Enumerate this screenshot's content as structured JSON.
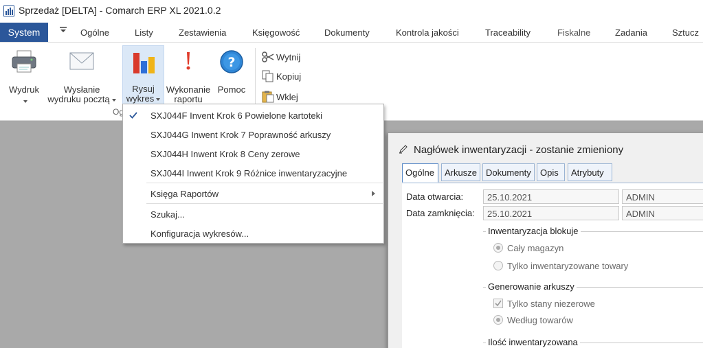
{
  "window": {
    "title": "Sprzedaż [DELTA] - Comarch ERP XL 2021.0.2"
  },
  "menubar": {
    "system": "System",
    "items": [
      "Ogólne",
      "Listy",
      "Zestawienia",
      "Księgowość",
      "Dokumenty",
      "Kontrola jakości",
      "Traceability",
      "Fiskalne",
      "Zadania",
      "Sztucz"
    ]
  },
  "ribbon": {
    "wydruk": "Wydruk",
    "wyslanie_line1": "Wysłanie",
    "wyslanie_line2": "wydruku pocztą",
    "rysuj_line1": "Rysuj",
    "rysuj_line2": "wykres",
    "wykonanie_line1": "Wykonanie",
    "wykonanie_line2": "raportu",
    "pomoc": "Pomoc",
    "wytnij": "Wytnij",
    "kopiuj": "Kopiuj",
    "wklej": "Wklej",
    "group_label": "Og"
  },
  "dropdown": {
    "items": [
      {
        "label": "SXJ044F Invent Krok 6 Powielone kartoteki",
        "checked": true
      },
      {
        "label": "SXJ044G Inwent Krok 7 Poprawność arkuszy",
        "checked": false
      },
      {
        "label": "SXJ044H Inwent Krok 8 Ceny zerowe",
        "checked": false
      },
      {
        "label": "SXJ044I Inwent Krok 9 Różnice inwentaryzacyjne",
        "checked": false
      }
    ],
    "ksiega": "Księga Raportów",
    "szukaj": "Szukaj...",
    "konfiguracja": "Konfiguracja wykresów..."
  },
  "dialog": {
    "title": "Nagłówek inwentaryzacji - zostanie zmieniony",
    "tabs": [
      "Ogólne",
      "Arkusze",
      "Dokumenty",
      "Opis",
      "Atrybuty"
    ],
    "data_otwarcia_label": "Data otwarcia:",
    "data_otwarcia_value": "25.10.2021",
    "data_otwarcia_user": "ADMIN",
    "data_zamkniecia_label": "Data zamknięcia:",
    "data_zamkniecia_value": "25.10.2021",
    "data_zamkniecia_user": "ADMIN",
    "blokuje_title": "Inwentaryzacja blokuje",
    "caly_magazyn": "Cały magazyn",
    "tylko_inw": "Tylko inwentaryzowane towary",
    "generowanie_title": "Generowanie arkuszy",
    "tylko_stany": "Tylko stany niezerowe",
    "wedlug_towarow": "Według towarów",
    "ilosc_title": "Ilość inwentaryzowana",
    "selected": {
      "blokuje": "Cały magazyn",
      "generowanie": "Według towarów",
      "tylko_stany_checked": true
    }
  }
}
